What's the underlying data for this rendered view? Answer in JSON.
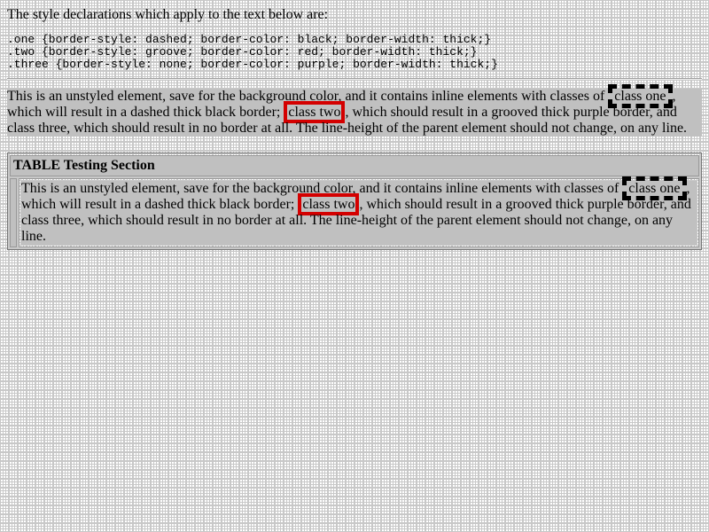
{
  "intro_text": "The style declarations which apply to the text below are:",
  "declarations": [
    ".one {border-style: dashed; border-color: black; border-width: thick;}",
    ".two {border-style: groove; border-color: red; border-width: thick;}",
    ".three {border-style: none; border-color: purple; border-width: thick;}"
  ],
  "paragraph": {
    "part1": "This is an unstyled element, save for the background color, and it contains inline elements with classes of ",
    "class_one": "class one",
    "part2": ", which will result in a dashed thick black border; ",
    "class_two": "class two",
    "part3": ", which should result in a grooved thick purple border, and ",
    "class_three": "class three",
    "part4": ", which should result in no border at all. The line-height of the parent element should not change, on any line."
  },
  "table": {
    "heading": "TABLE Testing Section"
  },
  "colors": {
    "background": "#ffffff",
    "paragraph_background": "#c0c0c0",
    "class_one_border": "#000000",
    "class_two_border": "#d40000"
  }
}
